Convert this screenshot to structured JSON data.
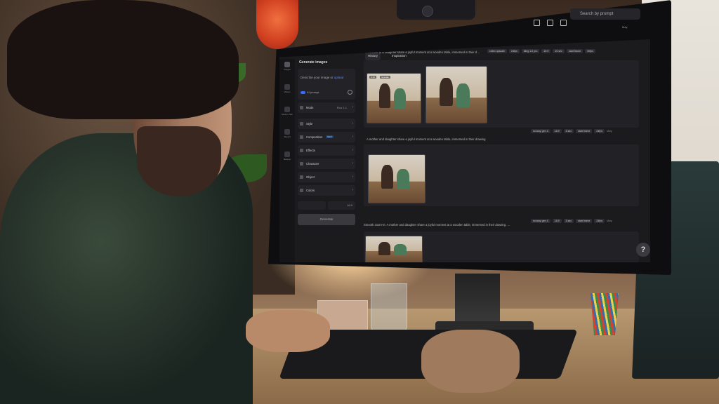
{
  "app": {
    "panel_title": "Generate images",
    "prompt_placeholder": "Describe your image or",
    "prompt_upload_link": "upload",
    "ai_prompt_label": "AI prompt",
    "mode_label": "Mode",
    "mode_value": "Flux 1.1",
    "settings": [
      "Style",
      "Composition",
      "Effects",
      "Character",
      "Object",
      "Colors"
    ],
    "composition_badge": "NEW",
    "aspect_value": "16:9",
    "generate_label": "Generate"
  },
  "rail": {
    "items": [
      "Images",
      "Videos",
      "Motion Path",
      "Sketch",
      "Backup"
    ]
  },
  "toolbar": {
    "history_label": "History",
    "inspiration_label": "Inspiration",
    "search_placeholder": "Search by prompt"
  },
  "cards": [
    {
      "prompt": "A mother and daughter share a joyful moment at a wooden table, immersed in their d…",
      "chips": [
        "video upscale",
        "24fps",
        "kling 1.6 pro",
        "16:9",
        "10 sec",
        "start frame",
        "30fps"
      ],
      "status": "May",
      "thumb_tags": [
        "0:10",
        "Upscale"
      ]
    },
    {
      "prompt": "A mother and daughter share a joyful moment at a wooden table, immersed in their drawing",
      "chips": [
        "runway gen 4",
        "16:9",
        "5 sec",
        "start frame",
        "24fps"
      ],
      "status": "May"
    },
    {
      "prompt": "Smooth zoom-in: A mother and daughter share a joyful moment at a wooden table, immersed in their drawing. …",
      "chips": [
        "runway gen 4",
        "16:9",
        "5 sec",
        "start frame",
        "24fps"
      ],
      "status": "May"
    }
  ],
  "help_label": "?"
}
